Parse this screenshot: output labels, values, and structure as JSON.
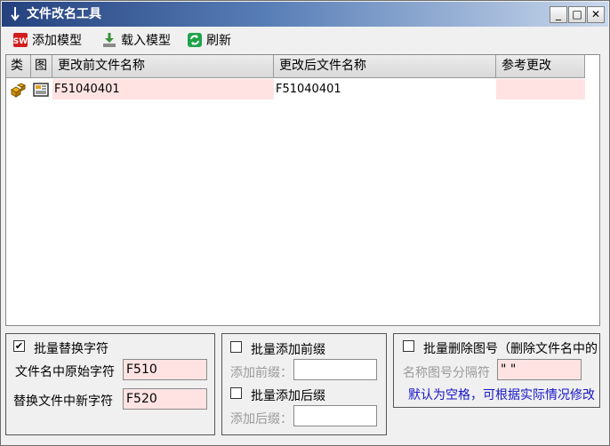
{
  "window": {
    "title": "文件改名工具",
    "controls": {
      "minimize": "_",
      "maximize": "□",
      "close": "✕"
    }
  },
  "toolbar": {
    "add_label": "添加模型",
    "load_label": "载入模型",
    "refresh_label": "刷新"
  },
  "list": {
    "columns": [
      "类",
      "图",
      "更改前文件名称",
      "更改后文件名称",
      "参考更改"
    ],
    "rows": [
      {
        "type_icon": "part-icon",
        "img_icon": "drawing-icon",
        "before": "F51040401",
        "after": "F51040401",
        "ref": ""
      }
    ]
  },
  "replace_group": {
    "checkbox_label": "批量替换字符",
    "checked": true,
    "original_label": "文件名中原始字符",
    "original_value": "F510",
    "new_label": "替换文件中新字符",
    "new_value": "F520"
  },
  "affix_group": {
    "prefix_checkbox_label": "批量添加前缀",
    "prefix_field_label": "添加前缀：",
    "prefix_value": "",
    "suffix_checkbox_label": "批量添加后缀",
    "suffix_field_label": "添加后缀：",
    "suffix_value": ""
  },
  "delete_group": {
    "checkbox_label": "批量删除图号（删除文件名中的",
    "separator_label": "名称图号分隔符",
    "separator_value": "\" \"",
    "hint": "默认为空格，可根据实际情况修改"
  },
  "colors": {
    "title_gradient_start": "#24417e",
    "highlight_cell": "#ffe3e3",
    "hint_text": "#1515c8"
  }
}
